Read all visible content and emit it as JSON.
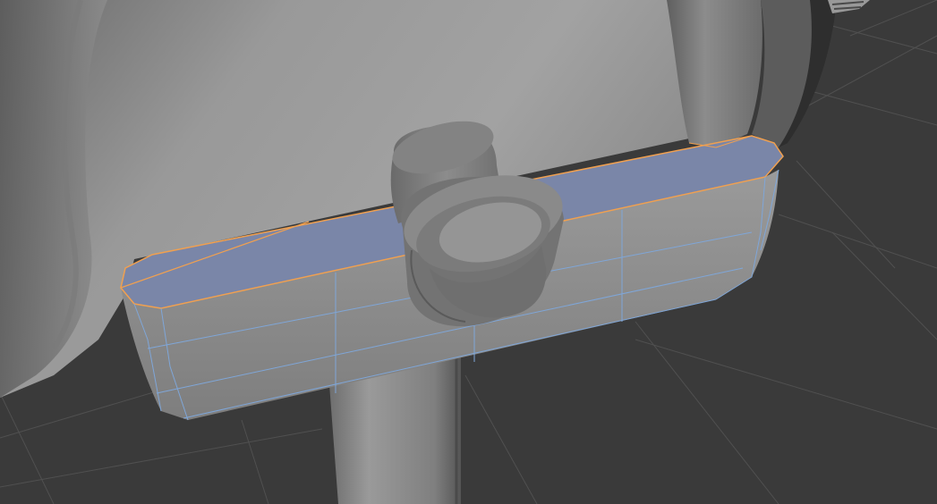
{
  "viewport": {
    "background_color": "#3a3a3a",
    "grid_line_color": "#505050",
    "grid_visible": true,
    "display_mode": "shaded-with-wireframe-on-selection"
  },
  "scene_objects": {
    "body": {
      "shading_color": "#8f8f8f",
      "selected": false
    },
    "ring": {
      "shading_color": "#7a7a7a",
      "selected": false
    },
    "stand_post": {
      "shading_color": "#8a8a8a",
      "selected": false
    },
    "knob": {
      "shading_color": "#7d7d7d",
      "selected": false
    },
    "handle_bar": {
      "shading_color": "#8c8c8c",
      "selected": true,
      "selected_face_color": "#7a86a8",
      "selected_edge_color": "#f0a050",
      "wireframe_color": "#7fa6d8"
    }
  }
}
